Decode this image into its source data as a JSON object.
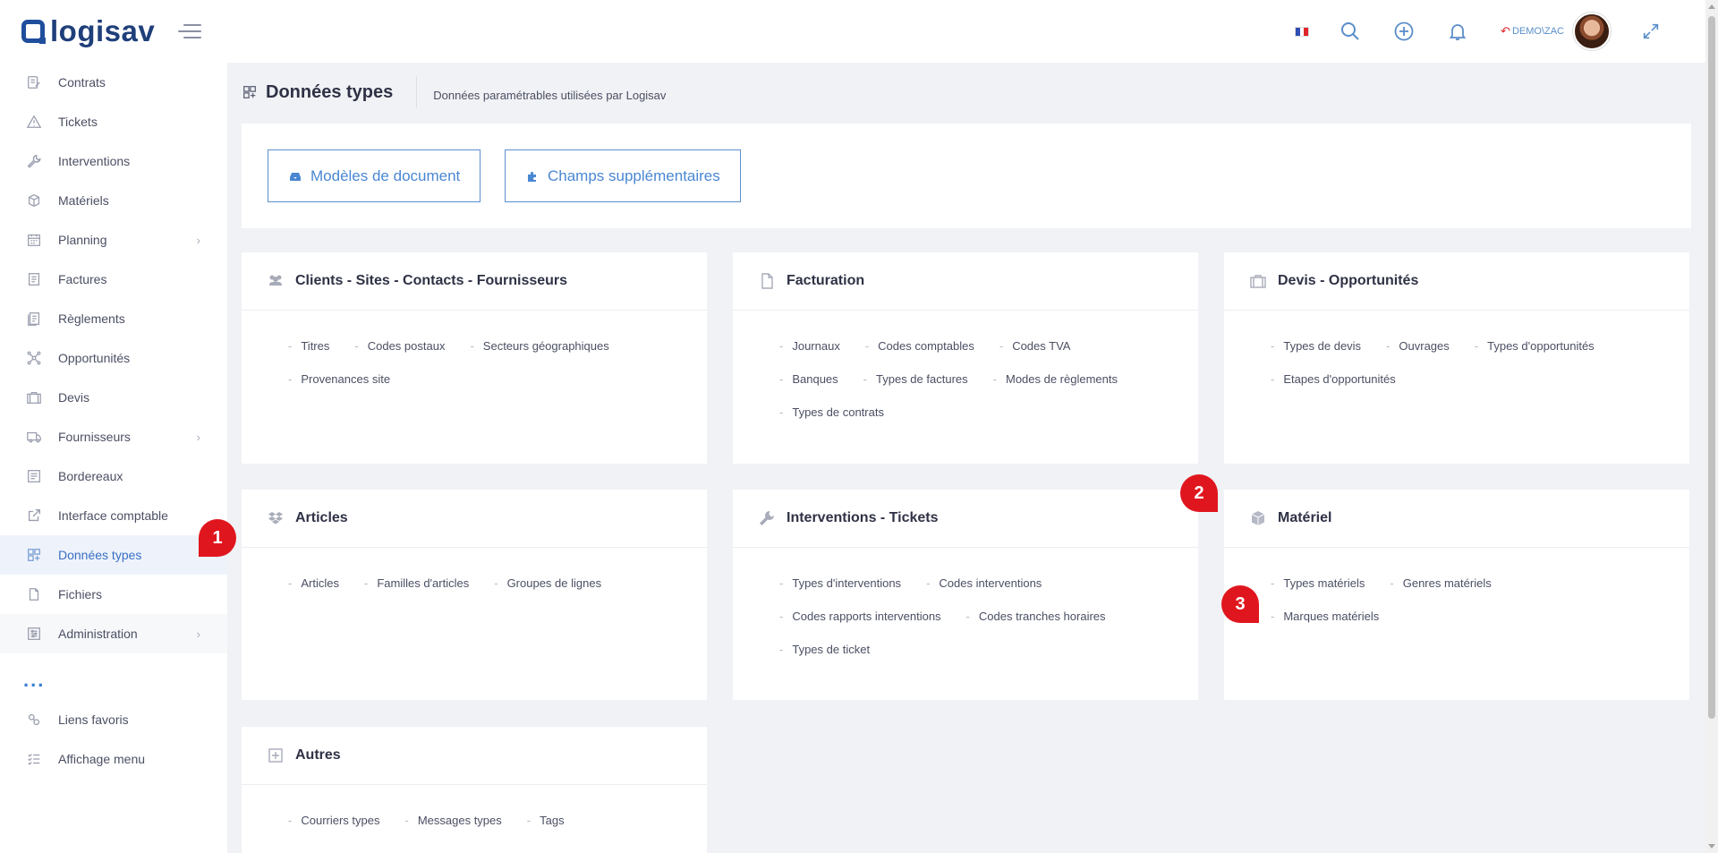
{
  "header": {
    "logo_text": "logisav",
    "user_label": "DEMO\\ZAC",
    "icons": [
      "flag-fr-icon",
      "search-icon",
      "add-circle-icon",
      "bell-icon",
      "undo-icon",
      "avatar",
      "expand-icon"
    ],
    "flag_colors": [
      "#2f4fb4",
      "#ffffff",
      "#e0242c"
    ]
  },
  "sidebar": {
    "items": [
      {
        "label": "Contrats",
        "icon": "contract-icon"
      },
      {
        "label": "Tickets",
        "icon": "warning-icon"
      },
      {
        "label": "Interventions",
        "icon": "wrench-icon"
      },
      {
        "label": "Matériels",
        "icon": "cube-icon"
      },
      {
        "label": "Planning",
        "icon": "calendar-icon",
        "has_children": true
      },
      {
        "label": "Factures",
        "icon": "invoice-icon"
      },
      {
        "label": "Règlements",
        "icon": "payments-icon"
      },
      {
        "label": "Opportunités",
        "icon": "network-icon"
      },
      {
        "label": "Devis",
        "icon": "briefcase-icon"
      },
      {
        "label": "Fournisseurs",
        "icon": "truck-icon",
        "has_children": true
      },
      {
        "label": "Bordereaux",
        "icon": "list-document-icon"
      },
      {
        "label": "Interface comptable",
        "icon": "external-link-icon"
      },
      {
        "label": "Données types",
        "icon": "grid-add-icon",
        "active": true
      },
      {
        "label": "Fichiers",
        "icon": "file-icon"
      },
      {
        "label": "Administration",
        "icon": "admin-icon",
        "has_children": true
      }
    ],
    "more": "...",
    "bottom_items": [
      {
        "label": "Liens favoris",
        "icon": "link-icon"
      },
      {
        "label": "Affichage menu",
        "icon": "checklist-icon"
      }
    ]
  },
  "page": {
    "title": "Données types",
    "subtitle": "Données paramétrables utilisées par Logisav"
  },
  "buttons": {
    "models": "Modèles de document",
    "fields": "Champs supplémentaires"
  },
  "cards": {
    "clients": {
      "title": "Clients - Sites - Contacts - Fournisseurs",
      "links": [
        "Titres",
        "Codes postaux",
        "Secteurs géographiques",
        "Provenances site"
      ]
    },
    "facturation": {
      "title": "Facturation",
      "links": [
        "Journaux",
        "Codes comptables",
        "Codes TVA",
        "Banques",
        "Types de factures",
        "Modes de règlements",
        "Types de contrats"
      ]
    },
    "devis": {
      "title": "Devis - Opportunités",
      "links": [
        "Types de devis",
        "Ouvrages",
        "Types d'opportunités",
        "Etapes d'opportunités"
      ]
    },
    "articles": {
      "title": "Articles",
      "links": [
        "Articles",
        "Familles d'articles",
        "Groupes de lignes"
      ]
    },
    "interventions": {
      "title": "Interventions - Tickets",
      "links": [
        "Types d'interventions",
        "Codes interventions",
        "Codes rapports interventions",
        "Codes tranches horaires",
        "Types de ticket"
      ]
    },
    "materiel": {
      "title": "Matériel",
      "links": [
        "Types matériels",
        "Genres matériels",
        "Marques matériels"
      ]
    },
    "autres": {
      "title": "Autres",
      "links": [
        "Courriers types",
        "Messages types",
        "Tags"
      ]
    }
  },
  "markers": [
    "1",
    "2",
    "3"
  ],
  "colors": {
    "accent": "#4a87d2",
    "active_bg": "#eef3fb",
    "marker": "#e0161e",
    "page_bg": "#f0f2f5"
  }
}
